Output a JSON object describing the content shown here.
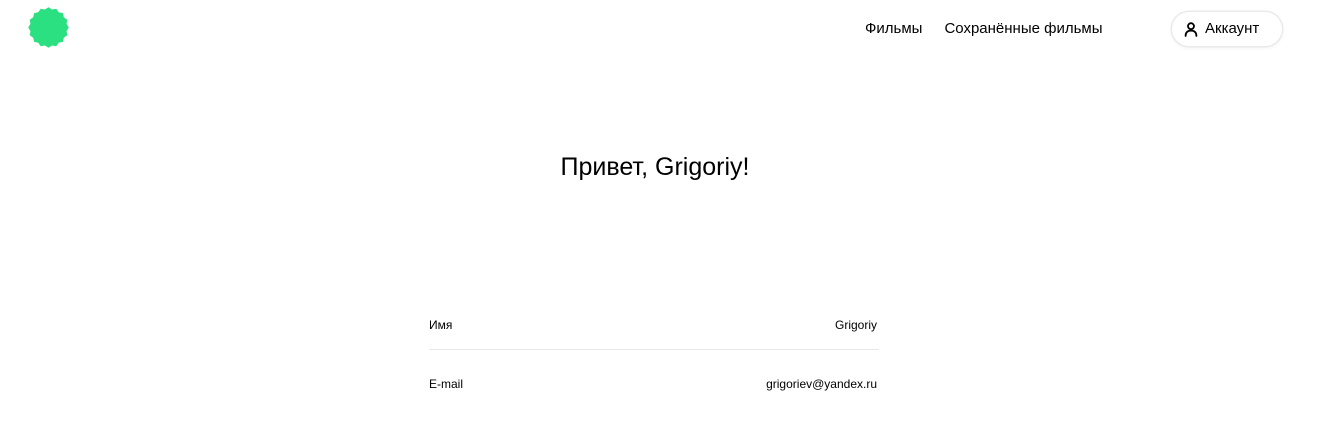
{
  "header": {
    "logo_icon": "green-badge-logo",
    "logo_color": "#2be080",
    "nav": {
      "movies": "Фильмы",
      "saved_movies": "Сохранённые фильмы"
    },
    "account": {
      "icon": "user-icon",
      "label": "Аккаунт"
    }
  },
  "profile": {
    "greeting": "Привет, Grigoriy!",
    "fields": [
      {
        "label": "Имя",
        "value": "Grigoriy"
      },
      {
        "label": "E-mail",
        "value": "grigoriev@yandex.ru"
      }
    ]
  }
}
